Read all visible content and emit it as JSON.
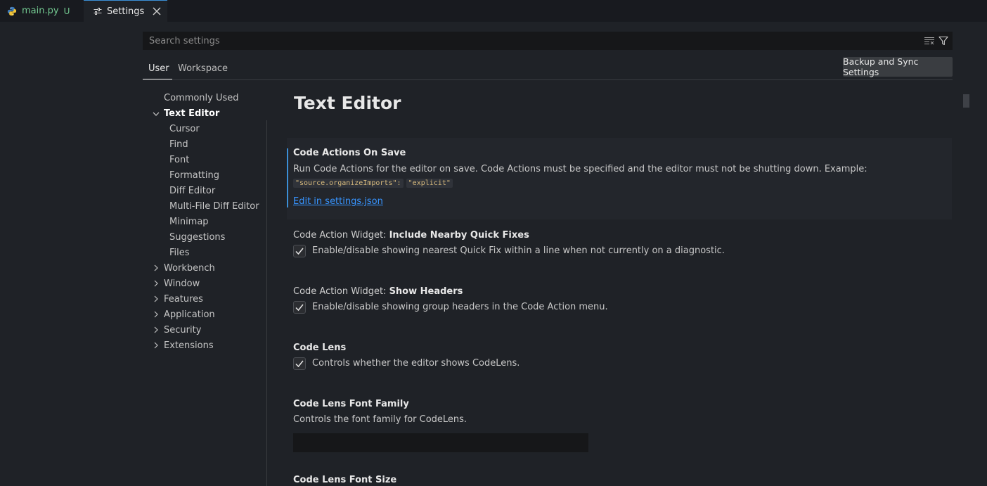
{
  "tabs": [
    {
      "label": "main.py",
      "badge": "U",
      "icon": "python-icon"
    },
    {
      "label": "Settings",
      "icon": "settings-editor-icon",
      "close": "close-icon"
    }
  ],
  "search": {
    "placeholder": "Search settings",
    "value": ""
  },
  "scope": {
    "user": "User",
    "workspace": "Workspace"
  },
  "sync_button": "Backup and Sync Settings",
  "toc": {
    "commonly_used": "Commonly Used",
    "text_editor": "Text Editor",
    "children": [
      "Cursor",
      "Find",
      "Font",
      "Formatting",
      "Diff Editor",
      "Multi-File Diff Editor",
      "Minimap",
      "Suggestions",
      "Files"
    ],
    "collapsed": [
      "Workbench",
      "Window",
      "Features",
      "Application",
      "Security",
      "Extensions"
    ]
  },
  "section_title": "Text Editor",
  "settings": {
    "code_actions_on_save": {
      "title": "Code Actions On Save",
      "desc": "Run Code Actions for the editor on save. Code Actions must be specified and the editor must not be shutting down. Example: ",
      "code1": "\"source.organizeImports\":",
      "code2": "\"explicit\"",
      "link": "Edit in settings.json"
    },
    "nearby_quick_fixes": {
      "category": "Code Action Widget: ",
      "title": "Include Nearby Quick Fixes",
      "desc": "Enable/disable showing nearest Quick Fix within a line when not currently on a diagnostic.",
      "checked": true
    },
    "show_headers": {
      "category": "Code Action Widget: ",
      "title": "Show Headers",
      "desc": "Enable/disable showing group headers in the Code Action menu.",
      "checked": true
    },
    "code_lens": {
      "title": "Code Lens",
      "desc": "Controls whether the editor shows CodeLens.",
      "checked": true
    },
    "code_lens_font_family": {
      "title": "Code Lens Font Family",
      "desc": "Controls the font family for CodeLens.",
      "value": ""
    },
    "code_lens_font_size": {
      "title": "Code Lens Font Size"
    }
  },
  "colors": {
    "accent": "#3b8fd6",
    "link": "#3794ff",
    "untracked": "#73c991",
    "background": "#1f2227"
  }
}
